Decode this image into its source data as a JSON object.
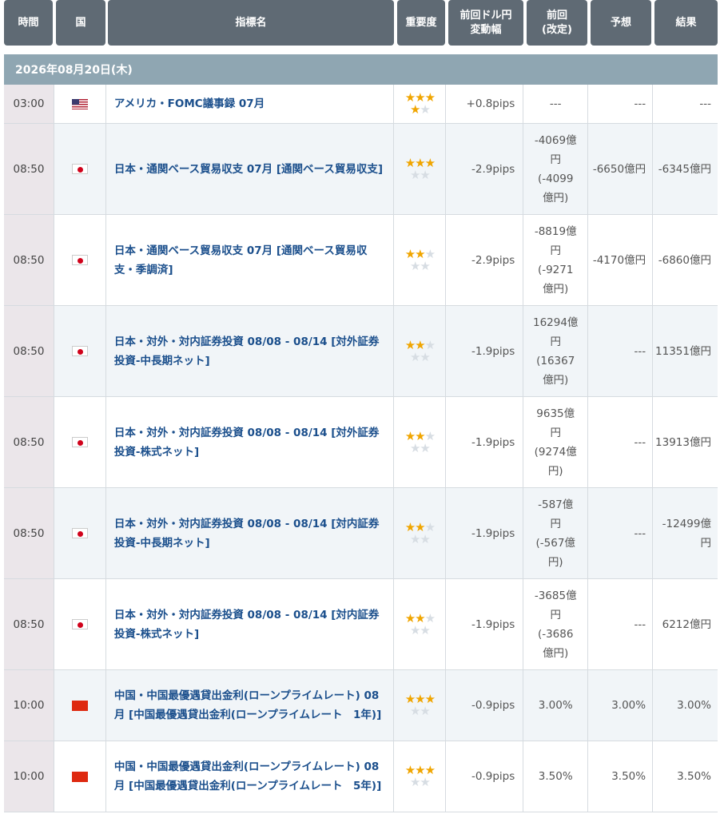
{
  "header": {
    "time": "時間",
    "country": "国",
    "indicator": "指標名",
    "importance": "重要度",
    "pips_line1": "前回ドル円",
    "pips_line2": "変動幅",
    "prev_line1": "前回",
    "prev_line2": "(改定)",
    "forecast": "予想",
    "result": "結果"
  },
  "date": "2026年08月20日(木)",
  "colors": {
    "header_bg": "#5f6a74",
    "date_bg": "#8fa6b2",
    "link": "#1b4f8c",
    "star": "#f0a500"
  },
  "rows": [
    {
      "time": "03:00",
      "flag_icon": "us-flag-icon",
      "name": "アメリカ・FOMC議事録 07月",
      "importance": 3.5,
      "pips": "+0.8pips",
      "prev": [
        "---"
      ],
      "forecast": "---",
      "result": "---"
    },
    {
      "time": "08:50",
      "flag_icon": "jp-flag-icon",
      "name": "日本・通関ベース貿易収支 07月 [通関ベース貿易収支]",
      "importance": 3,
      "pips": "-2.9pips",
      "prev": [
        "-4069億",
        "円",
        "(-4099",
        "億円)"
      ],
      "forecast": "-6650億円",
      "result": "-6345億円"
    },
    {
      "time": "08:50",
      "flag_icon": "jp-flag-icon",
      "name": "日本・通関ベース貿易収支 07月 [通関ベース貿易収支・季調済]",
      "importance": 2,
      "pips": "-2.9pips",
      "prev": [
        "-8819億",
        "円",
        "(-9271",
        "億円)"
      ],
      "forecast": "-4170億円",
      "result": "-6860億円"
    },
    {
      "time": "08:50",
      "flag_icon": "jp-flag-icon",
      "name": "日本・対外・対内証券投資 08/08 - 08/14 [対外証券投資-中長期ネット]",
      "importance": 2,
      "pips": "-1.9pips",
      "prev": [
        "16294億",
        "円",
        "(16367",
        "億円)"
      ],
      "forecast": "---",
      "result": "11351億円"
    },
    {
      "time": "08:50",
      "flag_icon": "jp-flag-icon",
      "name": "日本・対外・対内証券投資 08/08 - 08/14 [対外証券投資-株式ネット]",
      "importance": 2,
      "pips": "-1.9pips",
      "prev": [
        "9635億",
        "円",
        "(9274億",
        "円)"
      ],
      "forecast": "---",
      "result": "13913億円"
    },
    {
      "time": "08:50",
      "flag_icon": "jp-flag-icon",
      "name": "日本・対外・対内証券投資 08/08 - 08/14 [対内証券投資-中長期ネット]",
      "importance": 2,
      "pips": "-1.9pips",
      "prev": [
        "-587億",
        "円",
        "(-567億",
        "円)"
      ],
      "forecast": "---",
      "result": "-12499億円"
    },
    {
      "time": "08:50",
      "flag_icon": "jp-flag-icon",
      "name": "日本・対外・対内証券投資 08/08 - 08/14 [対内証券投資-株式ネット]",
      "importance": 2,
      "pips": "-1.9pips",
      "prev": [
        "-3685億",
        "円",
        "(-3686",
        "億円)"
      ],
      "forecast": "---",
      "result": "6212億円"
    },
    {
      "time": "10:00",
      "flag_icon": "cn-flag-icon",
      "name": "中国・中国最優遇貸出金利(ローンプライムレート) 08月 [中国最優遇貸出金利(ローンプライムレート　1年)]",
      "importance": 3,
      "pips": "-0.9pips",
      "prev": [
        "3.00%"
      ],
      "forecast": "3.00%",
      "result": "3.00%"
    },
    {
      "time": "10:00",
      "flag_icon": "cn-flag-icon",
      "name": "中国・中国最優遇貸出金利(ローンプライムレート) 08月 [中国最優遇貸出金利(ローンプライムレート　5年)]",
      "importance": 3,
      "pips": "-0.9pips",
      "prev": [
        "3.50%"
      ],
      "forecast": "3.50%",
      "result": "3.50%"
    }
  ]
}
